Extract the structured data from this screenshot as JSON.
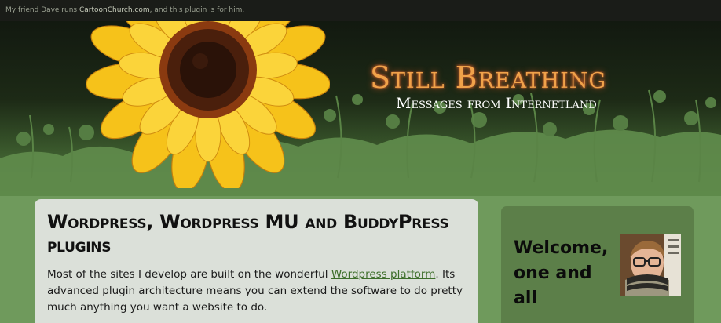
{
  "topbar": {
    "text_before": "My friend Dave runs ",
    "link_text": "CartoonChurch.com",
    "text_after": ", and this plugin is for him."
  },
  "header": {
    "site_title": "Still Breathing",
    "tagline": "Messages from Internetland",
    "colors": {
      "title": "#f0a24a",
      "title_glow": "#c7562a",
      "foliage": "#6f9a5c"
    }
  },
  "main": {
    "heading": "Wordpress, Wordpress MU and BuddyPress plugins",
    "intro_before": "Most of the sites I develop are built on the wonderful ",
    "intro_link": "Wordpress platform",
    "intro_after": ". Its advanced plugin architecture means you can extend the software to do pretty much anything you want a website to do."
  },
  "sidebar": {
    "welcome_title": "Welcome, one and all"
  }
}
